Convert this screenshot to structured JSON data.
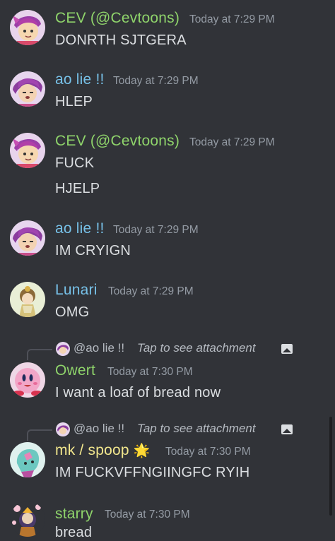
{
  "messages": [
    {
      "author": "CEV (@Cevtoons)",
      "author_color": "#8fd46b",
      "timestamp": "Today at 7:29 PM",
      "lines": [
        "DONRTH SJTGERA"
      ],
      "avatar": "cev-avatar"
    },
    {
      "author": "ao lie !!",
      "author_color": "#77c1e8",
      "timestamp": "Today at 7:29 PM",
      "lines": [
        "HLEP"
      ],
      "avatar": "ao-lie-avatar"
    },
    {
      "author": "CEV (@Cevtoons)",
      "author_color": "#8fd46b",
      "timestamp": "Today at 7:29 PM",
      "lines": [
        "FUCK",
        "HJELP"
      ],
      "avatar": "cev-avatar"
    },
    {
      "author": "ao lie !!",
      "author_color": "#77c1e8",
      "timestamp": "Today at 7:29 PM",
      "lines": [
        "IM CRYIGN"
      ],
      "avatar": "ao-lie-avatar"
    },
    {
      "author": "Lunari",
      "author_color": "#77c1e8",
      "timestamp": "Today at 7:29 PM",
      "lines": [
        "OMG"
      ],
      "avatar": "lunari-avatar"
    },
    {
      "reply": {
        "author": "@ao lie !!",
        "text": "Tap to see attachment",
        "icon": "image-icon"
      },
      "author": "Owert",
      "author_color": "#8fd46b",
      "timestamp": "Today at 7:30 PM",
      "lines": [
        "I want a loaf of bread now"
      ],
      "avatar": "owert-avatar"
    },
    {
      "reply": {
        "author": "@ao lie !!",
        "text": "Tap to see attachment",
        "icon": "image-icon"
      },
      "author": "mk / spoop",
      "author_color": "#f1e68d",
      "author_emoji": "🌟",
      "timestamp": "Today at 7:30 PM",
      "lines": [
        "IM FUCKVFFNGIINGFC RYIH"
      ],
      "avatar": "mk-avatar"
    },
    {
      "author": "starry",
      "author_color": "#8fd46b",
      "timestamp": "Today at 7:30 PM",
      "lines": [
        "bread"
      ],
      "avatar": "starry-avatar"
    }
  ]
}
